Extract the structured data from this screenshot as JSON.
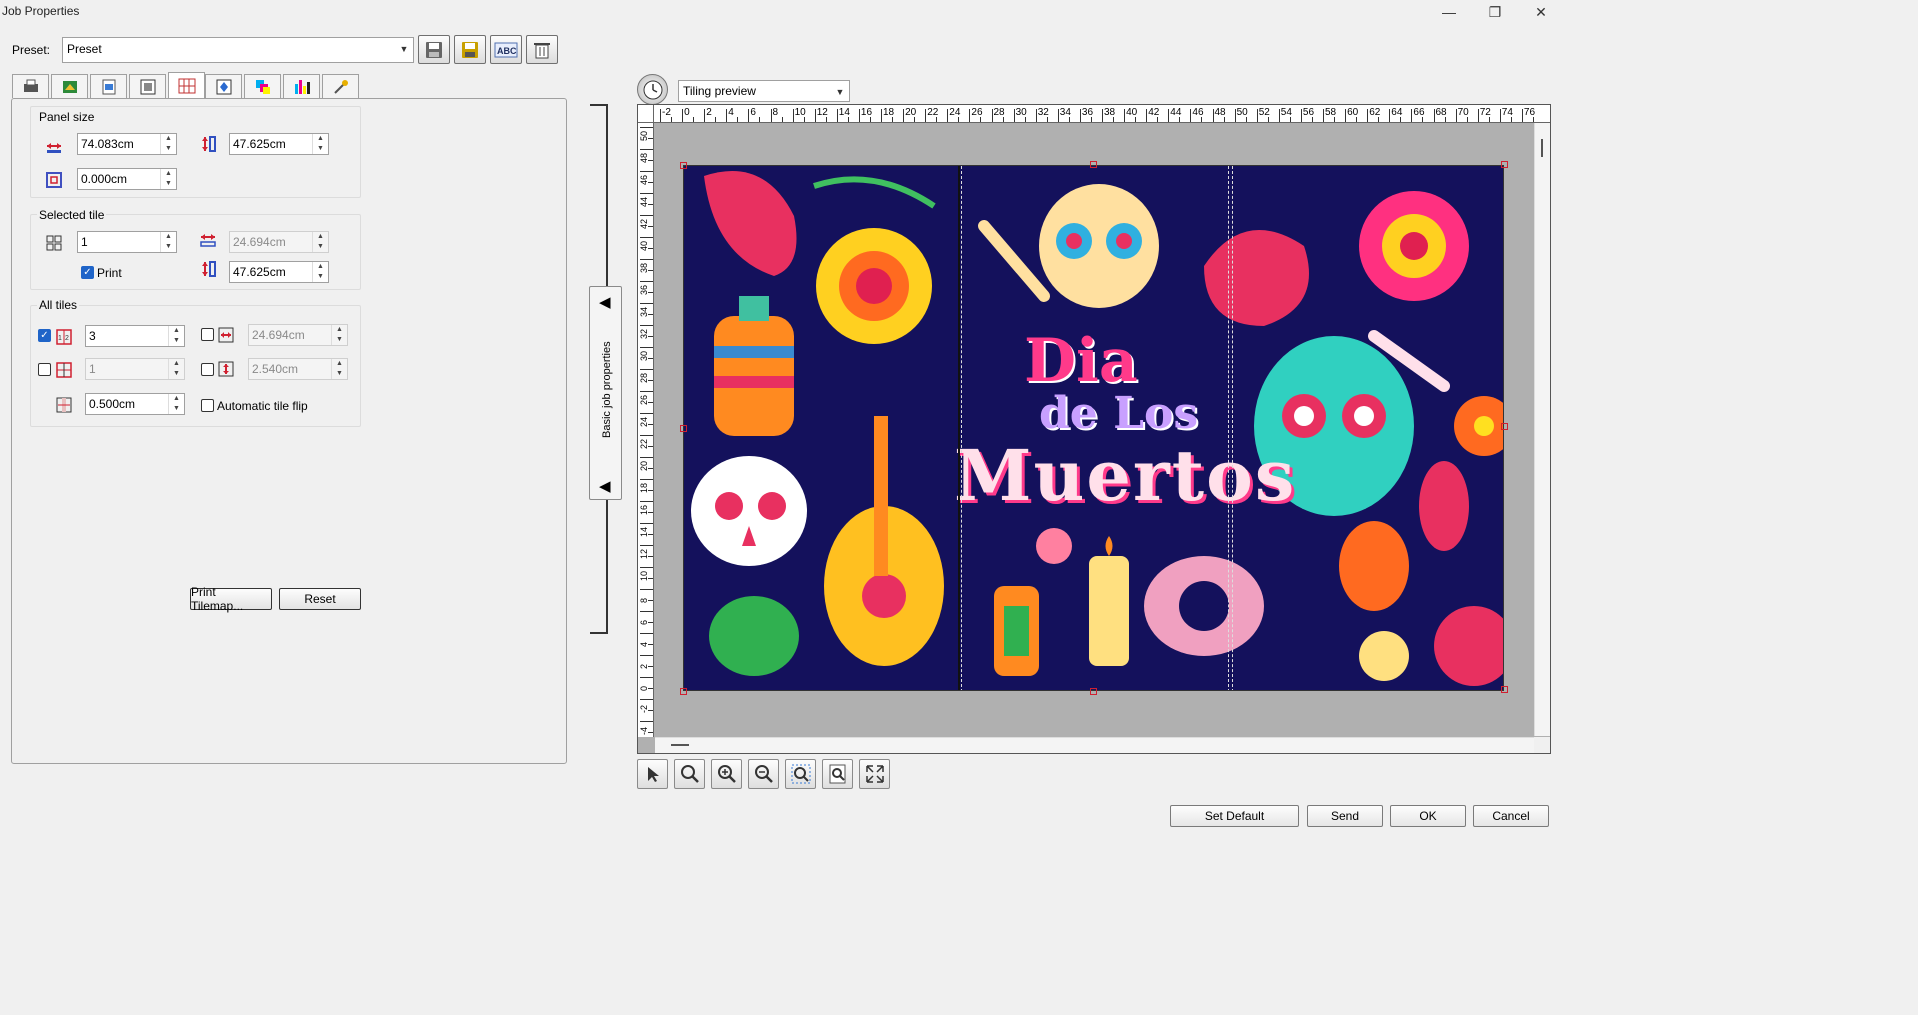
{
  "window": {
    "title": "Job Properties",
    "minimize": "—",
    "restore": "❐",
    "close": "✕"
  },
  "preset": {
    "label": "Preset:",
    "value": "Preset"
  },
  "panel_size": {
    "title": "Panel size",
    "width": "74.083cm",
    "height": "47.625cm",
    "offset": "0.000cm"
  },
  "selected_tile": {
    "title": "Selected tile",
    "number": "1",
    "width": "24.694cm",
    "height": "47.625cm",
    "print_label": "Print"
  },
  "all_tiles": {
    "title": "All tiles",
    "columns": "3",
    "rows": "1",
    "width": "24.694cm",
    "height": "2.540cm",
    "overlap": "0.500cm",
    "flip_label": "Automatic tile flip"
  },
  "buttons": {
    "print_tilemap": "Print Tilemap...",
    "reset": "Reset",
    "set_default": "Set Default",
    "send": "Send",
    "ok": "OK",
    "cancel": "Cancel"
  },
  "side_tab": {
    "label": "Basic job properties"
  },
  "preview": {
    "mode": "Tiling preview"
  },
  "artwork": {
    "line1": "Dia",
    "line2": "de Los",
    "line3": "Muertos"
  },
  "ruler": {
    "h": [
      "-2",
      "0",
      "2",
      "4",
      "6",
      "8",
      "10",
      "12",
      "14",
      "16",
      "18",
      "20",
      "22",
      "24",
      "26",
      "28",
      "30",
      "32",
      "34",
      "36",
      "38",
      "40",
      "42",
      "44",
      "46",
      "48",
      "50",
      "52",
      "54",
      "56",
      "58",
      "60",
      "62",
      "64",
      "66",
      "68",
      "70",
      "72",
      "74",
      "76"
    ],
    "v": [
      "50",
      "48",
      "46",
      "44",
      "42",
      "40",
      "38",
      "36",
      "34",
      "32",
      "30",
      "28",
      "26",
      "24",
      "22",
      "20",
      "18",
      "16",
      "14",
      "12",
      "10",
      "8",
      "6",
      "4",
      "2",
      "0",
      "-2",
      "-4"
    ]
  }
}
